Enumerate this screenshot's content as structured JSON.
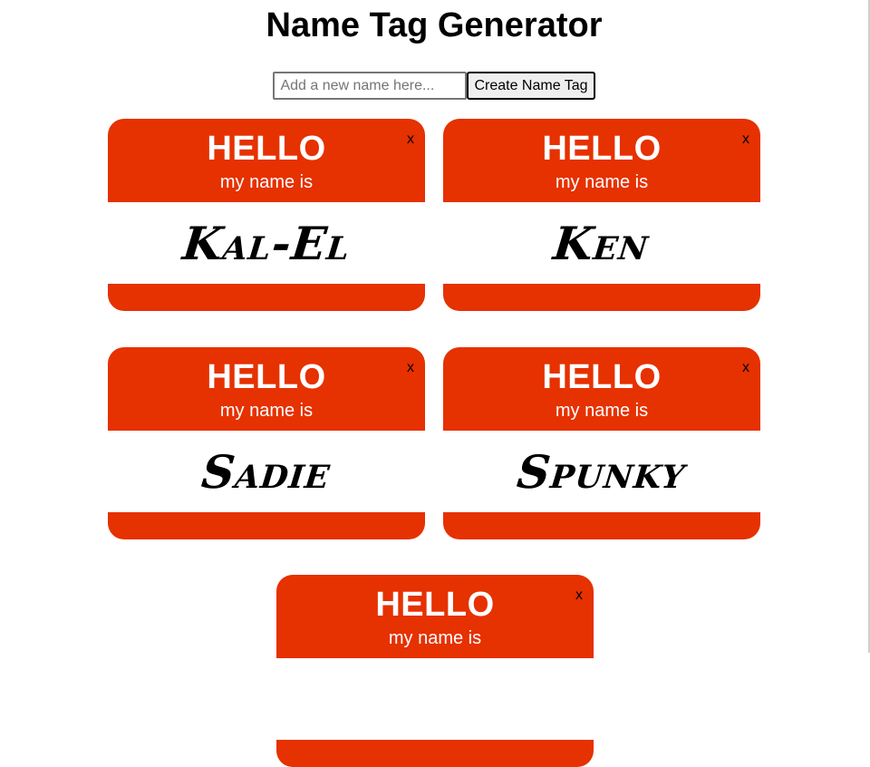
{
  "app": {
    "title": "Name Tag Generator"
  },
  "form": {
    "input_value": "",
    "input_placeholder": "Add a new name here...",
    "button_label": "Create Name Tag"
  },
  "tag_template": {
    "hello": "HELLO",
    "subtitle": "my name is",
    "close_label": "x"
  },
  "tags": [
    {
      "name": "Kal-El"
    },
    {
      "name": "Ken"
    },
    {
      "name": "Sadie"
    },
    {
      "name": "Spunky"
    },
    {
      "name": ""
    }
  ],
  "colors": {
    "tag_red": "#e63100",
    "name_area": "#ffffff",
    "text_white": "#ffffff"
  }
}
